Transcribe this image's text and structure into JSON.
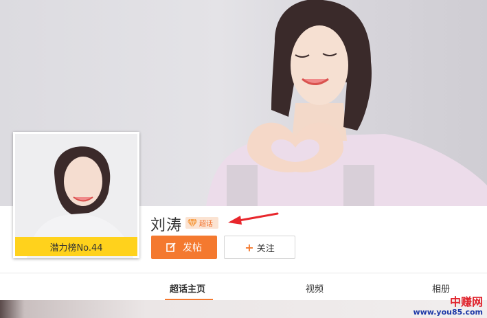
{
  "profile": {
    "name": "刘涛",
    "badge_label": "超话",
    "rank_label": "潜力榜No.44"
  },
  "actions": {
    "post_label": "发帖",
    "follow_label": "关注",
    "follow_prefix": "+"
  },
  "tabs": [
    {
      "label": "超话主页",
      "active": true
    },
    {
      "label": "视频",
      "active": false
    },
    {
      "label": "相册",
      "active": false
    }
  ],
  "watermark": {
    "site_name": "中赚网",
    "url": "www.you85.com"
  },
  "colors": {
    "accent": "#f4792f",
    "rank_bar": "#ffd21c",
    "annotation_arrow": "#e8262c"
  }
}
